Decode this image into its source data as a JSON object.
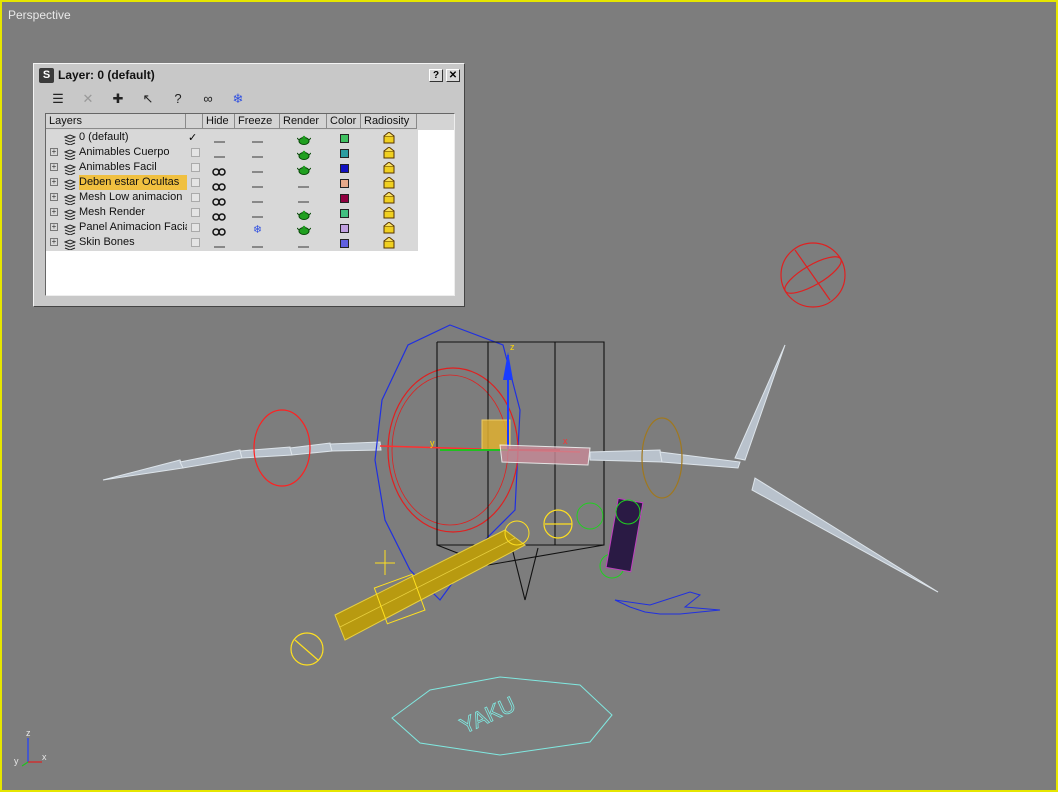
{
  "viewport": {
    "label": "Perspective"
  },
  "dialog": {
    "title": "Layer: 0 (default)",
    "help_label": "?",
    "close_label": "✕",
    "toolbar_icons": [
      "layers-icon",
      "delete-icon",
      "add-icon",
      "select-icon",
      "highlight-icon",
      "hide-icon",
      "freeze-icon"
    ],
    "columns": [
      "Layers",
      "",
      "Hide",
      "Freeze",
      "Render",
      "Color",
      "Radiosity"
    ],
    "layers": [
      {
        "name": "0 (default)",
        "expandable": false,
        "current": true,
        "hide": "off",
        "freeze": "off",
        "render": "on",
        "color": "#3fc060",
        "selected": false
      },
      {
        "name": "Animables Cuerpo",
        "expandable": true,
        "current": false,
        "hide": "off",
        "freeze": "off",
        "render": "on",
        "color": "#2a9ca0",
        "selected": false
      },
      {
        "name": "Animables Facil",
        "expandable": true,
        "current": false,
        "hide": "on",
        "freeze": "off",
        "render": "on",
        "color": "#1010c0",
        "selected": false
      },
      {
        "name": "Deben estar Ocultas",
        "expandable": true,
        "current": false,
        "hide": "on",
        "freeze": "off",
        "render": "off",
        "color": "#e6a98a",
        "selected": true
      },
      {
        "name": "Mesh Low animacion",
        "expandable": true,
        "current": false,
        "hide": "on",
        "freeze": "off",
        "render": "off",
        "color": "#900040",
        "selected": false
      },
      {
        "name": "Mesh Render",
        "expandable": true,
        "current": false,
        "hide": "on",
        "freeze": "off",
        "render": "on",
        "color": "#40c080",
        "selected": false
      },
      {
        "name": "Panel Animacion Facial",
        "expandable": true,
        "current": false,
        "hide": "on",
        "freeze": "on",
        "render": "on",
        "color": "#c0a0e0",
        "selected": false
      },
      {
        "name": "Skin Bones",
        "expandable": true,
        "current": false,
        "hide": "off",
        "freeze": "off",
        "render": "off",
        "color": "#6060e0",
        "selected": false
      }
    ]
  },
  "scene": {
    "floor_text": "YAKU"
  },
  "axis_gizmo": {
    "z": "z",
    "x": "x",
    "y": "y"
  },
  "colors": {
    "viewport_border": "#e6e600",
    "viewport_bg": "#7d7d7d",
    "selection": "#f0c040"
  }
}
